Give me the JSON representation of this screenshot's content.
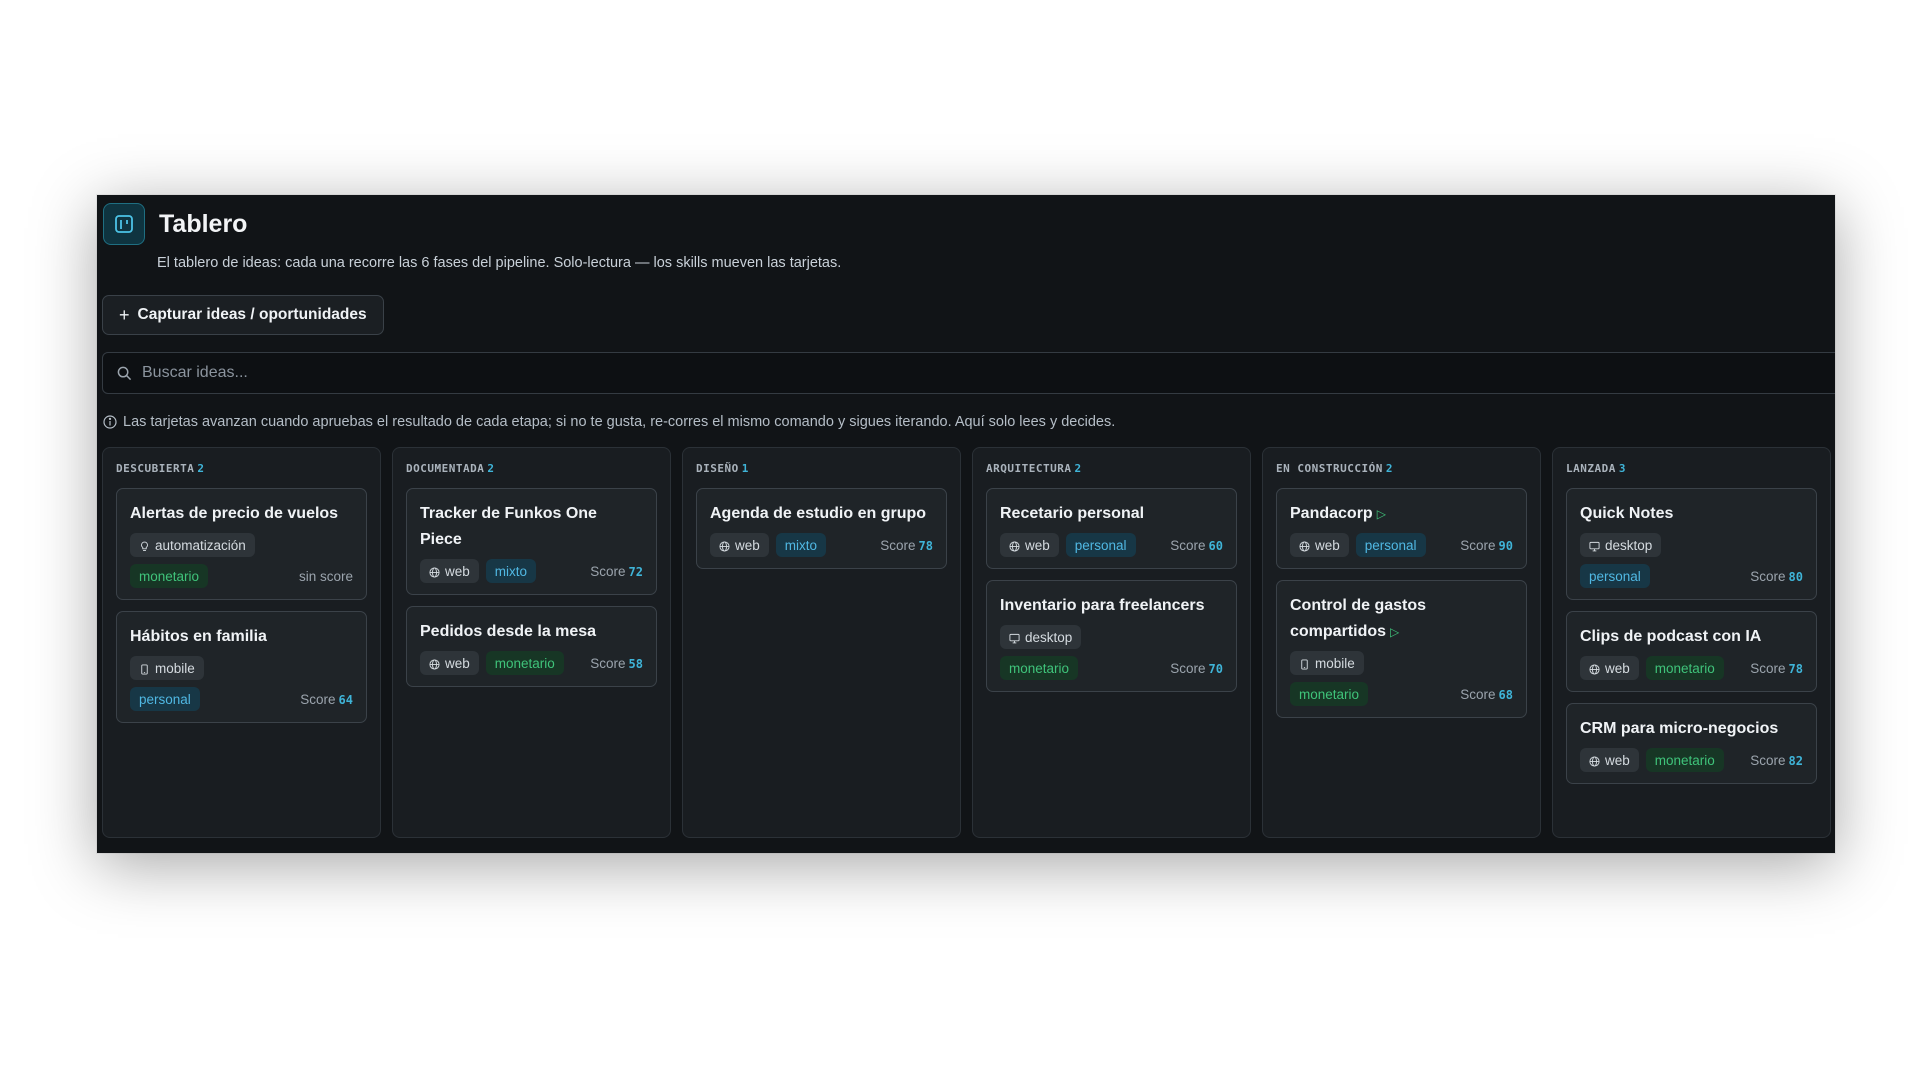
{
  "header": {
    "title": "Tablero",
    "subtitle": "El tablero de ideas: cada una recorre las 6 fases del pipeline. Solo-lectura — los skills mueven las tarjetas."
  },
  "capture_button": {
    "label": "Capturar ideas / oportunidades"
  },
  "search": {
    "placeholder": "Buscar ideas..."
  },
  "note": "Las tarjetas avanzan cuando apruebas el resultado de cada etapa; si no te gusta, re-corres el mismo comando y sigues iterando. Aquí solo lees y decides.",
  "score_label": "Score",
  "colors": {
    "accent": "#3fb4d8",
    "monetario": "#3fc37a",
    "personal": "#50b8e3",
    "background": "#111417"
  },
  "columns": [
    {
      "name": "DESCUBIERTA",
      "count": "2",
      "cards": [
        {
          "title": "Alertas de precio de vuelos",
          "tech": "automatización",
          "tech_icon": "lightbulb-icon",
          "model": "monetario",
          "score": "sin score",
          "stacked": true
        },
        {
          "title": "Hábitos en familia",
          "tech": "mobile",
          "tech_icon": "phone-icon",
          "model": "personal",
          "score": "64",
          "stacked": true
        }
      ]
    },
    {
      "name": "DOCUMENTADA",
      "count": "2",
      "cards": [
        {
          "title": "Tracker de Funkos One Piece",
          "tech": "web",
          "tech_icon": "globe-icon",
          "model": "mixto",
          "score": "72"
        },
        {
          "title": "Pedidos desde la mesa",
          "tech": "web",
          "tech_icon": "globe-icon",
          "model": "monetario",
          "score": "58"
        }
      ]
    },
    {
      "name": "DISEÑO",
      "count": "1",
      "cards": [
        {
          "title": "Agenda de estudio en grupo",
          "tech": "web",
          "tech_icon": "globe-icon",
          "model": "mixto",
          "score": "78"
        }
      ]
    },
    {
      "name": "ARQUITECTURA",
      "count": "2",
      "cards": [
        {
          "title": "Recetario personal",
          "tech": "web",
          "tech_icon": "globe-icon",
          "model": "personal",
          "score": "60"
        },
        {
          "title": "Inventario para freelancers",
          "tech": "desktop",
          "tech_icon": "monitor-icon",
          "model": "monetario",
          "score": "70",
          "stacked": true
        }
      ]
    },
    {
      "name": "EN CONSTRUCCIÓN",
      "count": "2",
      "cards": [
        {
          "title": "Pandacorp",
          "play": true,
          "tech": "web",
          "tech_icon": "globe-icon",
          "model": "personal",
          "score": "90"
        },
        {
          "title": "Control de gastos compartidos",
          "play": true,
          "tech": "mobile",
          "tech_icon": "phone-icon",
          "model": "monetario",
          "score": "68",
          "stacked": true
        }
      ]
    },
    {
      "name": "LANZADA",
      "count": "3",
      "cards": [
        {
          "title": "Quick Notes",
          "tech": "desktop",
          "tech_icon": "monitor-icon",
          "model": "personal",
          "score": "80",
          "stacked": true
        },
        {
          "title": "Clips de podcast con IA",
          "tech": "web",
          "tech_icon": "globe-icon",
          "model": "monetario",
          "score": "78"
        },
        {
          "title": "CRM para micro-negocios",
          "tech": "web",
          "tech_icon": "globe-icon",
          "model": "monetario",
          "score": "82"
        }
      ]
    }
  ]
}
